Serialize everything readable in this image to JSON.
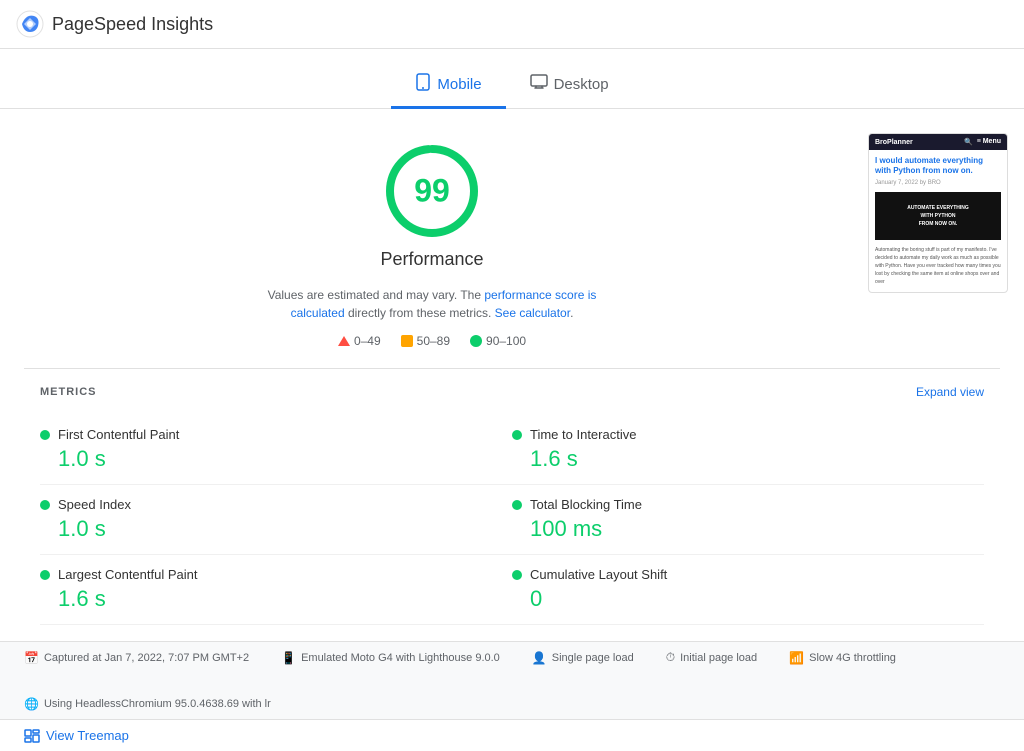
{
  "header": {
    "title": "PageSpeed Insights",
    "logo_alt": "PageSpeed Insights logo"
  },
  "tabs": {
    "items": [
      {
        "id": "mobile",
        "label": "Mobile",
        "active": true
      },
      {
        "id": "desktop",
        "label": "Desktop",
        "active": false
      }
    ]
  },
  "score": {
    "value": "99",
    "label": "Performance",
    "note_text": "Values are estimated and may vary. The ",
    "note_link_text": "performance score is calculated",
    "note_mid": " directly from these metrics. ",
    "note_link2": "See calculator",
    "note_end": "."
  },
  "legend": {
    "items": [
      {
        "id": "fail",
        "range": "0–49"
      },
      {
        "id": "average",
        "range": "50–89"
      },
      {
        "id": "pass",
        "range": "90–100"
      }
    ]
  },
  "preview": {
    "site_name": "BroPlanner",
    "title": "I would automate everything with Python from now on.",
    "date": "January 7, 2022 by BRO",
    "image_text": "AUTOMATE EVERYTHING\nWITH PYTHON\nFROM NOW ON.",
    "body_text": "Automating the boring stuff is part of my manifesto. I've decided to automate my daily work as much as possible with Python. Have you ever tracked how many times you lost by checking the same item at online shops over and over"
  },
  "metrics": {
    "section_title": "METRICS",
    "expand_label": "Expand view",
    "items": [
      {
        "name": "First Contentful Paint",
        "value": "1.0 s",
        "col": "left"
      },
      {
        "name": "Time to Interactive",
        "value": "1.6 s",
        "col": "right"
      },
      {
        "name": "Speed Index",
        "value": "1.0 s",
        "col": "left"
      },
      {
        "name": "Total Blocking Time",
        "value": "100 ms",
        "col": "right"
      },
      {
        "name": "Largest Contentful Paint",
        "value": "1.6 s",
        "col": "left"
      },
      {
        "name": "Cumulative Layout Shift",
        "value": "0",
        "col": "right"
      }
    ]
  },
  "footer": {
    "items": [
      {
        "icon": "📅",
        "text": "Captured at Jan 7, 2022, 7:07 PM GMT+2"
      },
      {
        "icon": "📱",
        "text": "Emulated Moto G4 with Lighthouse 9.0.0"
      },
      {
        "icon": "👤",
        "text": "Single page load"
      },
      {
        "icon": "⏱",
        "text": "Initial page load"
      },
      {
        "icon": "📶",
        "text": "Slow 4G throttling"
      },
      {
        "icon": "🌐",
        "text": "Using HeadlessChromium 95.0.4638.69 with lr"
      }
    ]
  },
  "view_treemap": {
    "label": "View Treemap"
  }
}
